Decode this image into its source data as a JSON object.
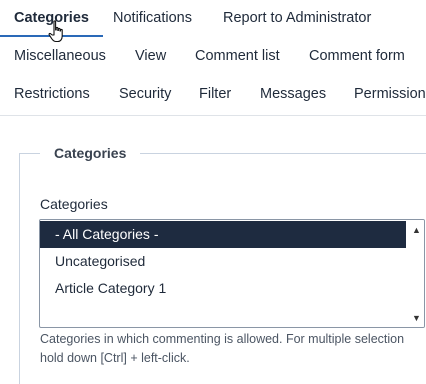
{
  "tabs": {
    "row1": [
      "Categories",
      "Notifications",
      "Report to Administrator"
    ],
    "row2": [
      "Miscellaneous",
      "View",
      "Comment list",
      "Comment form"
    ],
    "row3": [
      "Restrictions",
      "Security",
      "Filter",
      "Messages",
      "Permission"
    ]
  },
  "fieldset": {
    "legend": "Categories",
    "field_label": "Categories",
    "options": [
      "- All Categories -",
      "Uncategorised",
      "Article Category 1"
    ],
    "selected": "- All Categories -",
    "help": "Categories in which commenting is allowed. For multiple selection hold down [Ctrl] + left-click."
  },
  "colors": {
    "accent": "#2a69b8",
    "selected_bg": "#1e2b40"
  },
  "icons": {
    "cursor": "hand-pointer-icon",
    "scroll_up": "chevron-up-icon",
    "scroll_down": "chevron-down-icon"
  }
}
